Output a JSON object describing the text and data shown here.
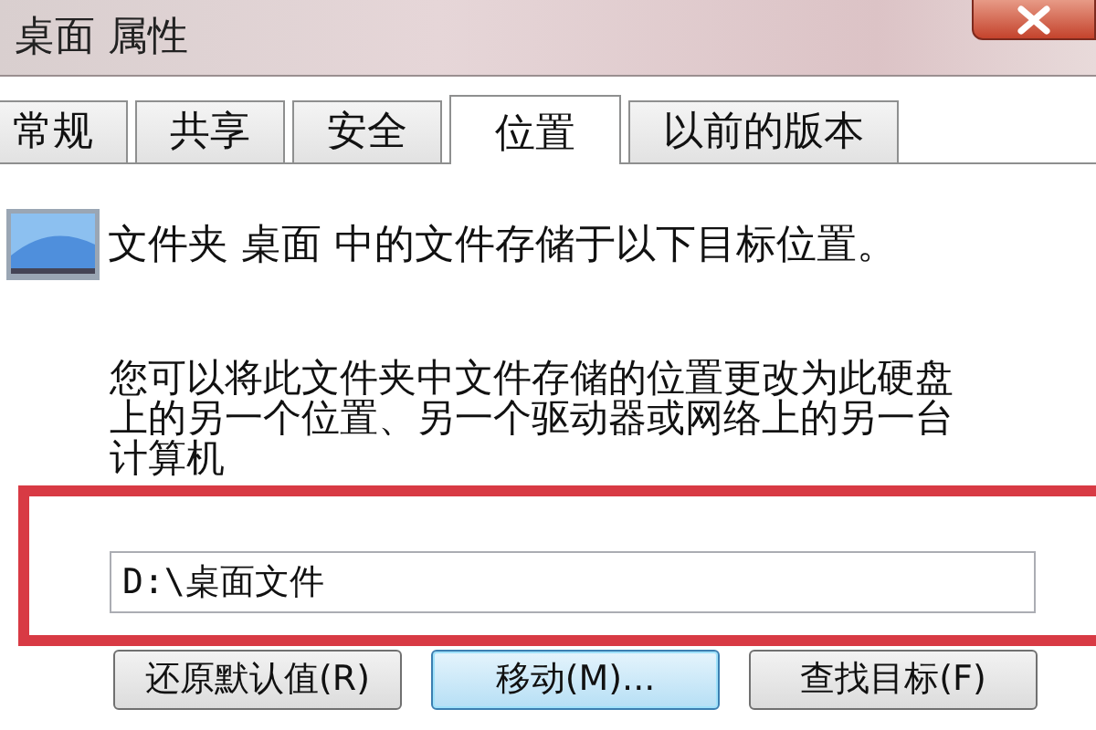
{
  "window": {
    "title": "桌面 属性"
  },
  "tabs": [
    {
      "label": "常规",
      "selected": false
    },
    {
      "label": "共享",
      "selected": false
    },
    {
      "label": "安全",
      "selected": false
    },
    {
      "label": "位置",
      "selected": true
    },
    {
      "label": "以前的版本",
      "selected": false
    }
  ],
  "location": {
    "description": "文件夹 桌面 中的文件存储于以下目标位置。",
    "hint": "您可以将此文件夹中文件存储的位置更改为此硬盘上的另一个位置、另一个驱动器或网络上的另一台计算机",
    "path": "D:\\桌面文件"
  },
  "buttons": [
    {
      "label": "还原默认值(R)",
      "focused": false
    },
    {
      "label": "移动(M)...",
      "focused": true
    },
    {
      "label": "查找目标(F)",
      "focused": false
    }
  ]
}
